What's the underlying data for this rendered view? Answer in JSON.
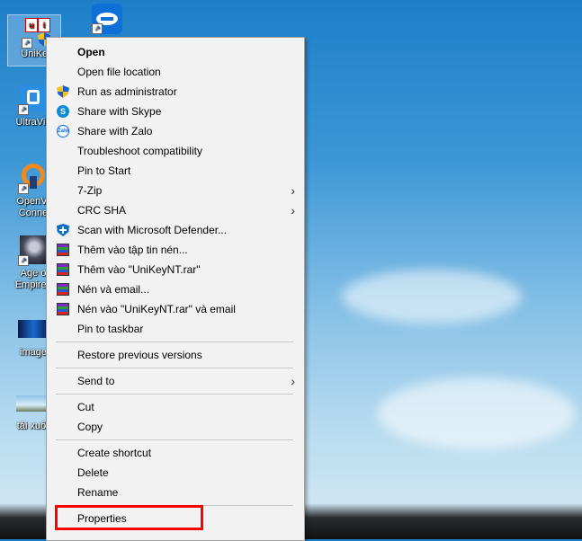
{
  "desktop": {
    "icons": [
      {
        "label": "UniKey"
      },
      {
        "label": ""
      },
      {
        "label": "UltraVie"
      },
      {
        "label": "OpenVI Conne"
      },
      {
        "label": "Age o Empires"
      },
      {
        "label": "image"
      },
      {
        "label": "tải xuố"
      }
    ]
  },
  "menu": {
    "items": [
      {
        "label": "Open",
        "icon": ""
      },
      {
        "label": "Open file location",
        "icon": ""
      },
      {
        "label": "Run as administrator",
        "icon": "uac-shield-icon"
      },
      {
        "label": "Share with Skype",
        "icon": "skype-icon"
      },
      {
        "label": "Share with Zalo",
        "icon": "zalo-icon",
        "icon_text": "Zalo"
      },
      {
        "label": "Troubleshoot compatibility",
        "icon": ""
      },
      {
        "label": "Pin to Start",
        "icon": ""
      },
      {
        "label": "7-Zip",
        "icon": "",
        "submenu": true
      },
      {
        "label": "CRC SHA",
        "icon": "",
        "submenu": true
      },
      {
        "label": "Scan with Microsoft Defender...",
        "icon": "defender-icon"
      },
      {
        "label": "Thêm vào tập tin nén...",
        "icon": "winrar-icon"
      },
      {
        "label": "Thêm vào \"UniKeyNT.rar\"",
        "icon": "winrar-icon"
      },
      {
        "label": "Nén và email...",
        "icon": "winrar-icon"
      },
      {
        "label": "Nén vào \"UniKeyNT.rar\" và email",
        "icon": "winrar-icon"
      },
      {
        "label": "Pin to taskbar",
        "icon": ""
      },
      {
        "label": "Restore previous versions",
        "icon": ""
      },
      {
        "label": "Send to",
        "icon": "",
        "submenu": true
      },
      {
        "label": "Cut",
        "icon": ""
      },
      {
        "label": "Copy",
        "icon": ""
      },
      {
        "label": "Create shortcut",
        "icon": ""
      },
      {
        "label": "Delete",
        "icon": ""
      },
      {
        "label": "Rename",
        "icon": ""
      },
      {
        "label": "Properties",
        "icon": ""
      }
    ],
    "submenu_arrow": "›",
    "skype_glyph": "S"
  },
  "colors": {
    "highlight": "#ff0000",
    "menu_bg": "#f2f2f2"
  }
}
